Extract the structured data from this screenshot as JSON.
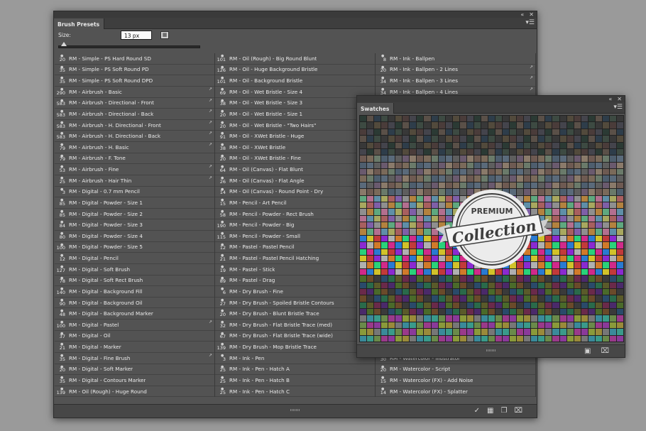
{
  "brush_panel": {
    "tab_label": "Brush Presets",
    "size_label": "Size:",
    "size_value": "13 px",
    "columns": [
      [
        {
          "n": "20",
          "name": "RM - Simple - PS Hard Round SD"
        },
        {
          "n": "35",
          "name": "RM - Simple - PS Soft Round PD"
        },
        {
          "n": "35",
          "name": "RM - Simple - PS Soft Round DPD"
        },
        {
          "n": "290",
          "name": "RM - Airbrush - Basic"
        },
        {
          "n": "583",
          "name": "RM - Airbrush - Directional - Front"
        },
        {
          "n": "583",
          "name": "RM - Airbrush - Directional - Back"
        },
        {
          "n": "583",
          "name": "RM - Airbrush - H. Directional - Front"
        },
        {
          "n": "583",
          "name": "RM - Airbrush - H. Directional - Back"
        },
        {
          "n": "79",
          "name": "RM - Airbrush - H. Basic"
        },
        {
          "n": "79",
          "name": "RM - Airbrush - F. Tone"
        },
        {
          "n": "53",
          "name": "RM - Airbrush - Fine"
        },
        {
          "n": "25",
          "name": "RM - Airbrush - Hair Thin"
        },
        {
          "n": "3",
          "name": "RM - Digital - 0.7 mm Pencil"
        },
        {
          "n": "85",
          "name": "RM - Digital - Powder - Size 1"
        },
        {
          "n": "85",
          "name": "RM - Digital - Powder - Size 2"
        },
        {
          "n": "84",
          "name": "RM - Digital - Powder - Size 3"
        },
        {
          "n": "80",
          "name": "RM - Digital - Powder - Size 4"
        },
        {
          "n": "100",
          "name": "RM - Digital - Powder - Size 5"
        },
        {
          "n": "12",
          "name": "RM - Digital - Pencil"
        },
        {
          "n": "127",
          "name": "RM - Digital - Soft Brush"
        },
        {
          "n": "78",
          "name": "RM - Digital - Soft Rect Brush"
        },
        {
          "n": "140",
          "name": "RM - Digital - Background Fill"
        },
        {
          "n": "90",
          "name": "RM - Digital - Background Oil"
        },
        {
          "n": "48",
          "name": "RM - Digital - Background Marker"
        },
        {
          "n": "100",
          "name": "RM - Digital - Pastel"
        },
        {
          "n": "37",
          "name": "RM - Digital - Oil"
        },
        {
          "n": "21",
          "name": "RM - Digital - Marker"
        },
        {
          "n": "35",
          "name": "RM - Digital - Fine Brush"
        },
        {
          "n": "20",
          "name": "RM - Digital - Soft Marker"
        },
        {
          "n": "35",
          "name": "RM - Digital - Contours Marker"
        },
        {
          "n": "139",
          "name": "RM - Oil (Rough) - Huge Round"
        }
      ],
      [
        {
          "n": "101",
          "name": "RM - Oil (Rough) - Big Round Blunt"
        },
        {
          "n": "126",
          "name": "RM - Oil - Huge Background Bristle"
        },
        {
          "n": "101",
          "name": "RM - Oil - Background Bristle"
        },
        {
          "n": "69",
          "name": "RM - Oil - Wet Bristle - Size 4"
        },
        {
          "n": "38",
          "name": "RM - Oil - Wet Bristle - Size 3"
        },
        {
          "n": "20",
          "name": "RM - Oil - Wet Bristle - Size 1"
        },
        {
          "n": "20",
          "name": "RM - Oil - Wet Bristle - \"Two Hairs\""
        },
        {
          "n": "91",
          "name": "RM - Oil - XWet Bristle - Huge"
        },
        {
          "n": "38",
          "name": "RM - Oil - XWet Bristle"
        },
        {
          "n": "20",
          "name": "RM - Oil - XWet Bristle - Fine"
        },
        {
          "n": "64",
          "name": "RM - Oil (Canvas) - Flat Blunt"
        },
        {
          "n": "26",
          "name": "RM - Oil (Canvas) - Flat Angle"
        },
        {
          "n": "14",
          "name": "RM - Oil (Canvas) - Round Point - Dry"
        },
        {
          "n": "15",
          "name": "RM - Pencil - Art Pencil"
        },
        {
          "n": "58",
          "name": "RM - Pencil - Powder - Rect Brush"
        },
        {
          "n": "190",
          "name": "RM - Pencil - Powder - Big"
        },
        {
          "n": "115",
          "name": "RM - Pencil - Powder - Small"
        },
        {
          "n": "12",
          "name": "RM - Pastel - Pastel Pencil"
        },
        {
          "n": "21",
          "name": "RM - Pastel - Pastel Pencil Hatching"
        },
        {
          "n": "19",
          "name": "RM - Pastel - Stick"
        },
        {
          "n": "89",
          "name": "RM - Pastel - Drag"
        },
        {
          "n": "6",
          "name": "RM - Dry Brush - Fine"
        },
        {
          "n": "27",
          "name": "RM - Dry Brush - Spoiled Bristle Contours"
        },
        {
          "n": "20",
          "name": "RM - Dry Brush - Blunt Bristle Trace"
        },
        {
          "n": "32",
          "name": "RM - Dry Brush - Flat Bristle Trace (med)"
        },
        {
          "n": "67",
          "name": "RM - Dry Brush - Flat Bristle Trace (wide)"
        },
        {
          "n": "139",
          "name": "RM - Dry Brush - Mop Bristle Trace"
        },
        {
          "n": "3",
          "name": "RM - Ink - Pen"
        },
        {
          "n": "25",
          "name": "RM - Ink - Pen - Hatch A"
        },
        {
          "n": "25",
          "name": "RM - Ink - Pen - Hatch B"
        },
        {
          "n": "25",
          "name": "RM - Ink - Pen - Hatch C"
        }
      ],
      [
        {
          "n": "8",
          "name": "RM - Ink - Ballpen"
        },
        {
          "n": "20",
          "name": "RM - Ink - Ballpen - 2 Lines"
        },
        {
          "n": "34",
          "name": "RM - Ink - Ballpen - 3 Lines"
        },
        {
          "n": "34",
          "name": "RM - Ink - Ballpen - 4 Lines"
        },
        {
          "n": "",
          "name": ""
        },
        {
          "n": "",
          "name": ""
        },
        {
          "n": "",
          "name": ""
        },
        {
          "n": "",
          "name": ""
        },
        {
          "n": "",
          "name": ""
        },
        {
          "n": "",
          "name": ""
        },
        {
          "n": "",
          "name": ""
        },
        {
          "n": "",
          "name": ""
        },
        {
          "n": "",
          "name": ""
        },
        {
          "n": "",
          "name": ""
        },
        {
          "n": "",
          "name": ""
        },
        {
          "n": "",
          "name": ""
        },
        {
          "n": "",
          "name": ""
        },
        {
          "n": "",
          "name": ""
        },
        {
          "n": "",
          "name": ""
        },
        {
          "n": "",
          "name": ""
        },
        {
          "n": "",
          "name": ""
        },
        {
          "n": "",
          "name": ""
        },
        {
          "n": "",
          "name": ""
        },
        {
          "n": "",
          "name": ""
        },
        {
          "n": "",
          "name": ""
        },
        {
          "n": "",
          "name": ""
        },
        {
          "n": "",
          "name": ""
        },
        {
          "n": "30",
          "name": "RM - Watercolor - Illustrator"
        },
        {
          "n": "20",
          "name": "RM - Watercolor - Script"
        },
        {
          "n": "15",
          "name": "RM - Watercolor (FX) - Add Noise"
        },
        {
          "n": "14",
          "name": "RM - Watercolor (FX) - Splatter"
        }
      ]
    ]
  },
  "swatch_panel": {
    "tab_label": "Swatches"
  },
  "badge": {
    "top_text": "PREMIUM",
    "main_text": "Collection"
  },
  "icons": {
    "collapse": "«",
    "close": "✕",
    "menu": "▾☰",
    "folder": "▦",
    "toggle_brush": "✓",
    "new_preset": "❐",
    "new_swatch": "▣",
    "trash": "⌧"
  },
  "colors": {
    "panel_bg": "#535353",
    "desktop_bg": "#9a9a9a",
    "badge_ribbon": "#ececec",
    "badge_text": "#3e3e3e"
  }
}
